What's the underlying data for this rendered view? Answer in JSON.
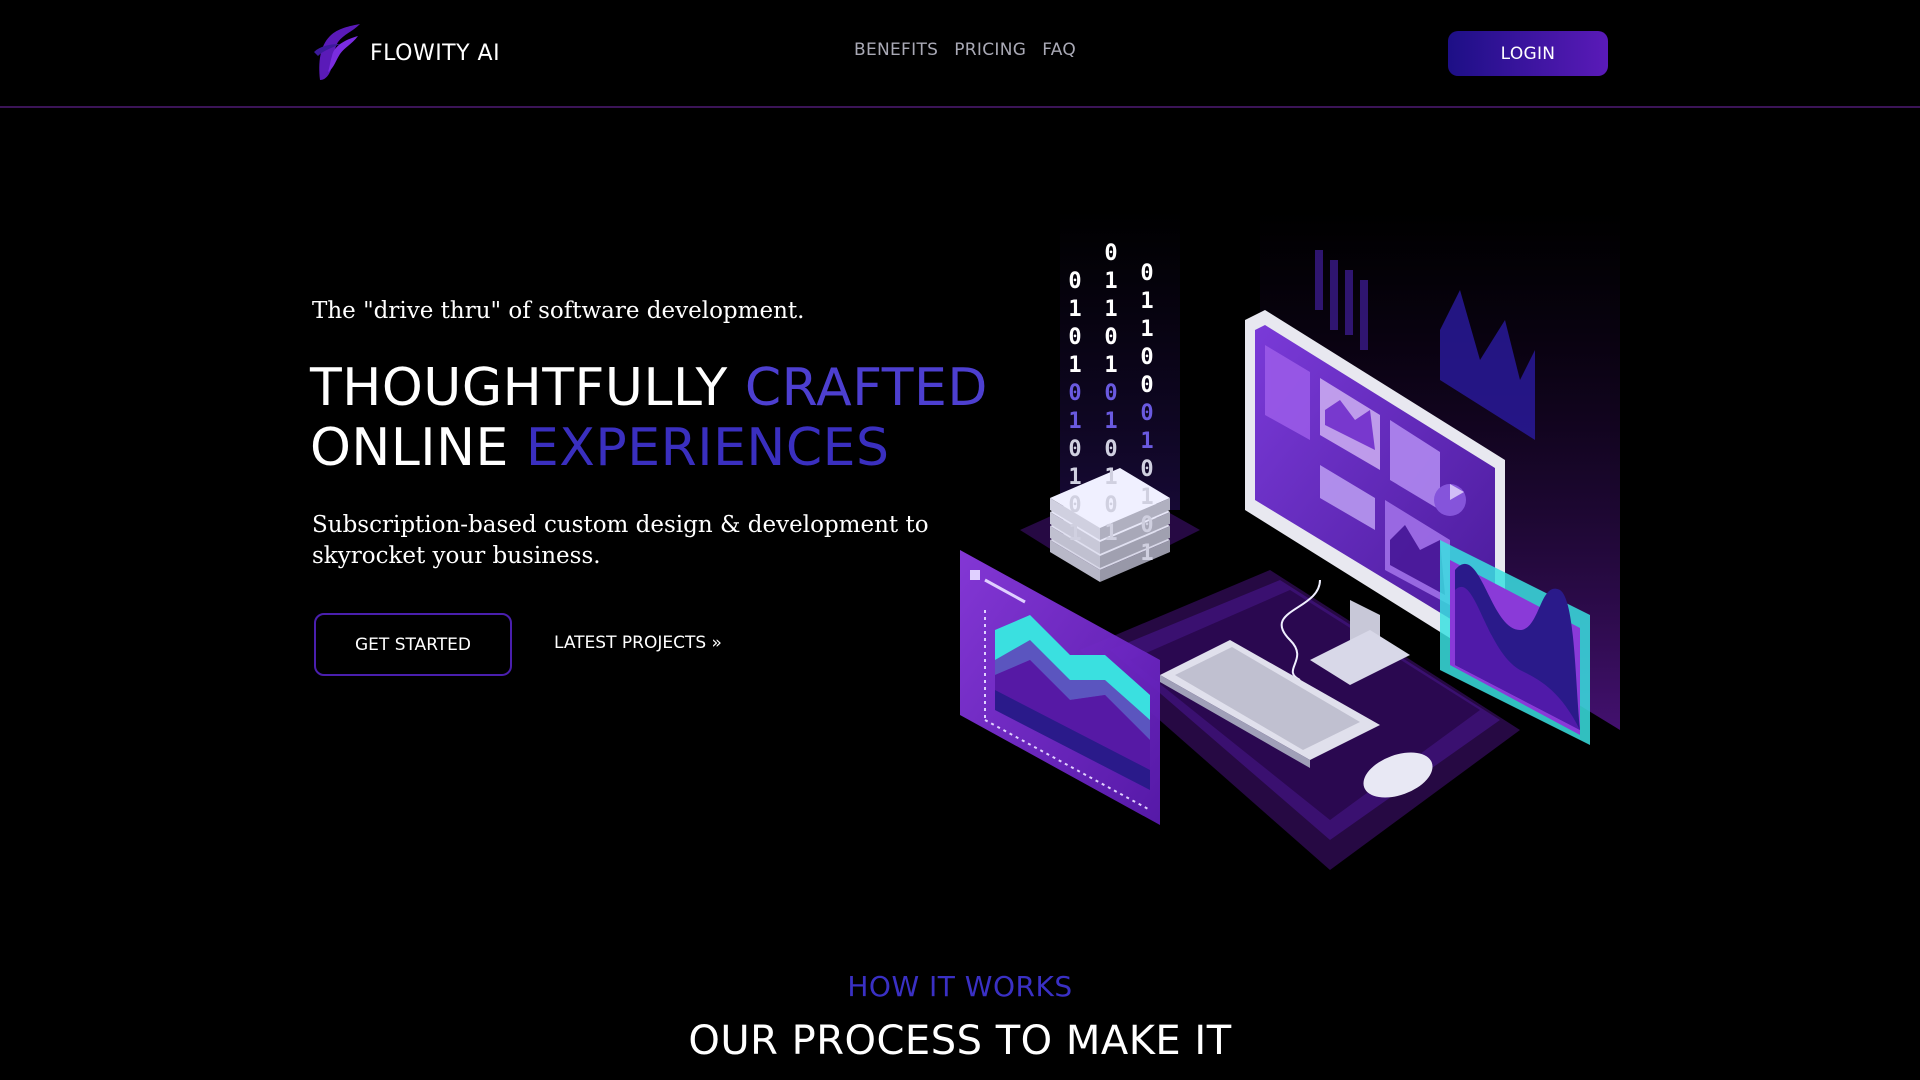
{
  "header": {
    "brand": "FLOWITY AI",
    "logo_icon": "flowity-logo",
    "nav": [
      {
        "label": "BENEFITS"
      },
      {
        "label": "PRICING"
      },
      {
        "label": "FAQ"
      }
    ],
    "login_label": "LOGIN"
  },
  "hero": {
    "tagline": "The \"drive thru\" of software development.",
    "headline": {
      "line1_white": "THOUGHTFULLY",
      "line1_accent": "CRAFTED",
      "line2_white": "ONLINE",
      "line2_accent": "EXPERIENCES"
    },
    "subtitle": "Subscription-based custom design & development to skyrocket your business.",
    "cta_primary": "GET STARTED",
    "cta_secondary": "LATEST PROJECTS »",
    "illustration": {
      "icon": "isometric-computer-illustration",
      "binary_columns": [
        [
          "0",
          "1",
          "0",
          "1",
          "0",
          "1",
          "0",
          "1",
          "0",
          "1"
        ],
        [
          "0",
          "1",
          "1",
          "0",
          "1",
          "0",
          "1",
          "0",
          "1",
          "0",
          "1"
        ],
        [
          "0",
          "1",
          "1",
          "0",
          "0",
          "0",
          "1",
          "0",
          "1",
          "0",
          "1"
        ]
      ]
    }
  },
  "how_it_works": {
    "eyebrow": "HOW IT WORKS",
    "title": "OUR PROCESS TO MAKE IT"
  },
  "colors": {
    "background": "#000000",
    "accent_purple": "#5a1ab8",
    "accent_blue": "#3a30c4",
    "divider": "#3b1457"
  }
}
